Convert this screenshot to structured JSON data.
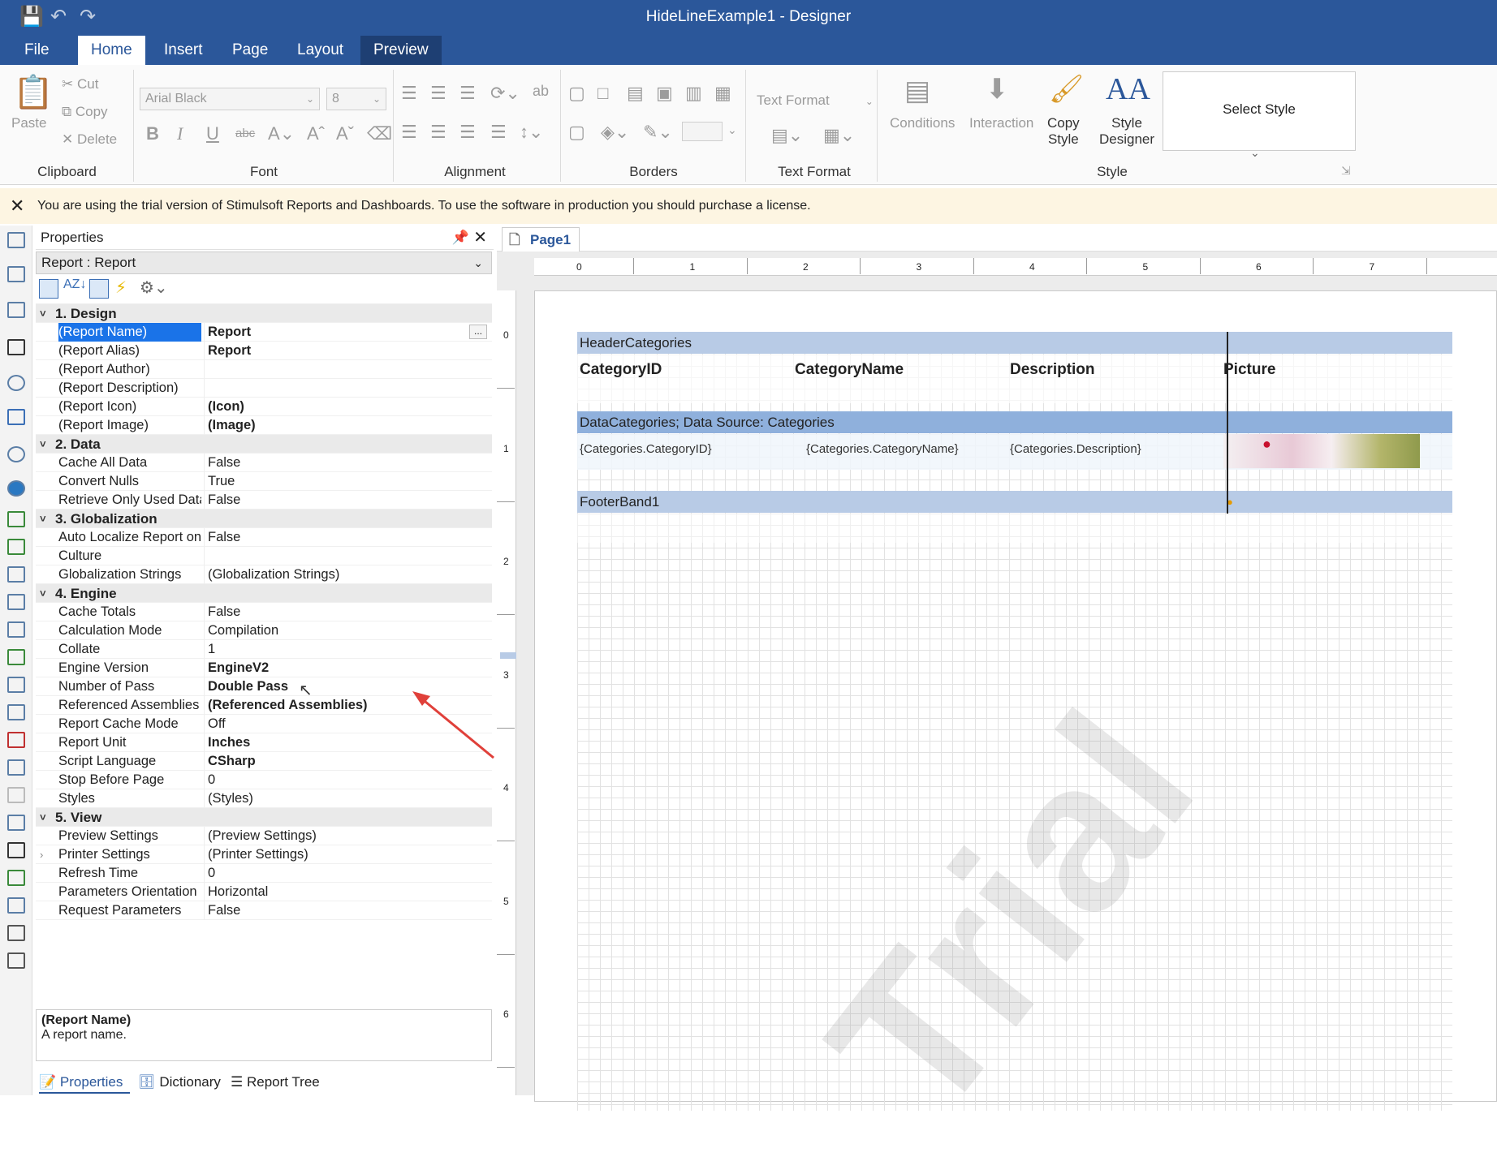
{
  "window": {
    "title": "HideLineExample1 - Designer"
  },
  "tabs": [
    "File",
    "Home",
    "Insert",
    "Page",
    "Layout",
    "Preview"
  ],
  "ribbon": {
    "clipboard": {
      "label": "Clipboard",
      "paste": "Paste",
      "cut": "Cut",
      "copy": "Copy",
      "delete": "Delete"
    },
    "font": {
      "label": "Font",
      "name": "Arial Black",
      "size": "8"
    },
    "alignment": {
      "label": "Alignment"
    },
    "borders": {
      "label": "Borders"
    },
    "text_format": {
      "label": "Text Format",
      "combo": "Text Format"
    },
    "conditions": "Conditions",
    "interaction": "Interaction",
    "copy_style": [
      "Copy",
      "Style"
    ],
    "style_designer": [
      "Style",
      "Designer"
    ],
    "style": {
      "label": "Style",
      "select": "Select Style"
    }
  },
  "trial_notice": "You are using the trial version of Stimulsoft Reports and Dashboards. To use the software in production you should purchase a license.",
  "properties": {
    "title": "Properties",
    "object": "Report : Report",
    "rows": [
      {
        "t": "sec",
        "n": "1. Design"
      },
      {
        "n": "(Report Name)",
        "v": "Report",
        "b": true,
        "sel": true
      },
      {
        "n": "(Report Alias)",
        "v": "Report",
        "b": true
      },
      {
        "n": "(Report Author)",
        "v": ""
      },
      {
        "n": "(Report Description)",
        "v": ""
      },
      {
        "n": "(Report Icon)",
        "v": "(Icon)",
        "b": true
      },
      {
        "n": "(Report Image)",
        "v": "(Image)",
        "b": true
      },
      {
        "t": "sec",
        "n": "2. Data"
      },
      {
        "n": "Cache All Data",
        "v": "False"
      },
      {
        "n": "Convert Nulls",
        "v": "True"
      },
      {
        "n": "Retrieve Only Used Data",
        "v": "False"
      },
      {
        "t": "sec",
        "n": "3. Globalization"
      },
      {
        "n": "Auto Localize Report on",
        "v": "False"
      },
      {
        "n": "Culture",
        "v": ""
      },
      {
        "n": "Globalization Strings",
        "v": "(Globalization Strings)"
      },
      {
        "t": "sec",
        "n": "4. Engine"
      },
      {
        "n": "Cache Totals",
        "v": "False"
      },
      {
        "n": "Calculation Mode",
        "v": "Compilation"
      },
      {
        "n": "Collate",
        "v": "1"
      },
      {
        "n": "Engine Version",
        "v": "EngineV2",
        "b": true
      },
      {
        "n": "Number of Pass",
        "v": "Double Pass",
        "b": true
      },
      {
        "n": "Referenced Assemblies",
        "v": "(Referenced Assemblies)",
        "b": true
      },
      {
        "n": "Report Cache Mode",
        "v": "Off"
      },
      {
        "n": "Report Unit",
        "v": "Inches",
        "b": true
      },
      {
        "n": "Script Language",
        "v": "CSharp",
        "b": true
      },
      {
        "n": "Stop Before Page",
        "v": "0"
      },
      {
        "n": "Styles",
        "v": "(Styles)"
      },
      {
        "t": "sec",
        "n": "5. View"
      },
      {
        "n": "Preview Settings",
        "v": "(Preview Settings)"
      },
      {
        "n": "Printer Settings",
        "v": "(Printer Settings)",
        "exp": true
      },
      {
        "n": "Refresh Time",
        "v": "0"
      },
      {
        "n": "Parameters Orientation",
        "v": "Horizontal"
      },
      {
        "n": "Request Parameters",
        "v": "False"
      }
    ],
    "desc_title": "(Report Name)",
    "desc_text": "A report name.",
    "bottom_tabs": [
      "Properties",
      "Dictionary",
      "Report Tree"
    ]
  },
  "designer": {
    "page_tab": "Page1",
    "hruler": [
      "0",
      "1",
      "2",
      "3",
      "4",
      "5",
      "6",
      "7"
    ],
    "vruler": [
      "0",
      "1",
      "2",
      "3",
      "4",
      "5",
      "6"
    ],
    "header_band": "HeaderCategories",
    "columns": [
      "CategoryID",
      "CategoryName",
      "Description",
      "Picture"
    ],
    "data_band": "DataCategories; Data Source: Categories",
    "data_cells": [
      "{Categories.CategoryID}",
      "{Categories.CategoryName}",
      "{Categories.Description}"
    ],
    "footer_band": "FooterBand1",
    "watermark": "Trial"
  }
}
